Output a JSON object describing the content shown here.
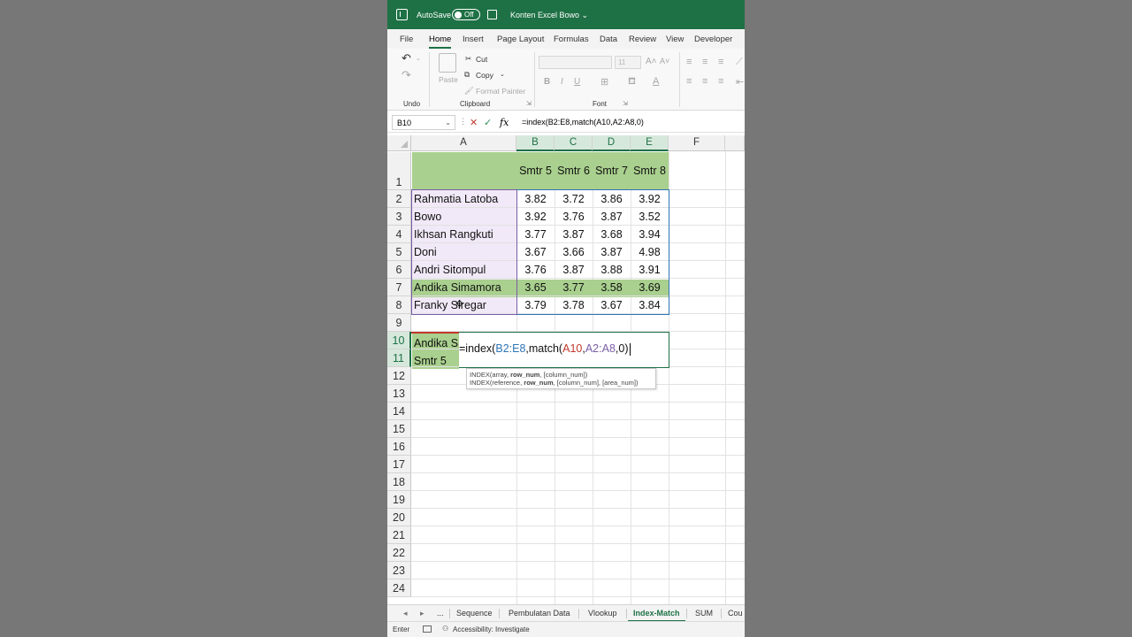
{
  "titlebar": {
    "autosave": "AutoSave",
    "toggle": "Off",
    "doc_title": "Konten Excel Bowo ⌄"
  },
  "ribbon_tabs": [
    "File",
    "Home",
    "Insert",
    "Page Layout",
    "Formulas",
    "Data",
    "Review",
    "View",
    "Developer"
  ],
  "ribbon": {
    "undo_label": "Undo",
    "clipboard_label": "Clipboard",
    "font_label": "Font",
    "paste": "Paste",
    "cut": "Cut",
    "copy": "Copy",
    "format_painter": "Format Painter",
    "font_size": "11"
  },
  "formula_bar": {
    "name_box": "B10",
    "formula": "=index(B2:E8,match(A10,A2:A8,0)"
  },
  "columns": [
    "A",
    "B",
    "C",
    "D",
    "E",
    "F"
  ],
  "rows": [
    "1",
    "2",
    "3",
    "4",
    "5",
    "6",
    "7",
    "8",
    "9",
    "10",
    "11",
    "12",
    "13",
    "14",
    "15",
    "16",
    "17",
    "18",
    "19",
    "20",
    "21",
    "22",
    "23",
    "24"
  ],
  "table": {
    "headers": [
      "Smtr 5",
      "Smtr 6",
      "Smtr 7",
      "Smtr 8"
    ],
    "data": [
      {
        "name": "Rahmatia Latoba",
        "values": [
          "3.82",
          "3.72",
          "3.86",
          "3.92"
        ]
      },
      {
        "name": "Bowo",
        "values": [
          "3.92",
          "3.76",
          "3.87",
          "3.52"
        ]
      },
      {
        "name": "Ikhsan Rangkuti",
        "values": [
          "3.77",
          "3.87",
          "3.68",
          "3.94"
        ]
      },
      {
        "name": "Doni",
        "values": [
          "3.67",
          "3.66",
          "3.87",
          "4.98"
        ]
      },
      {
        "name": "Andri Sitompul",
        "values": [
          "3.76",
          "3.87",
          "3.88",
          "3.91"
        ]
      },
      {
        "name": "Andika Simamora",
        "values": [
          "3.65",
          "3.77",
          "3.58",
          "3.69"
        ]
      },
      {
        "name": "Franky Siregar",
        "values": [
          "3.79",
          "3.78",
          "3.67",
          "3.84"
        ]
      }
    ]
  },
  "lookup": {
    "a10": "Andika S",
    "a11": "Smtr 5"
  },
  "editor": {
    "p1": "=index(",
    "r1": "B2:E8",
    "p2": ",match(",
    "r2": "A10",
    "p3": ",",
    "r3": "A2:A8",
    "p4": ",0)"
  },
  "tooltip": {
    "line1_a": "INDEX(array, ",
    "line1_b": "row_num",
    "line1_c": ", [column_num])",
    "line2_a": "INDEX(reference, ",
    "line2_b": "row_num",
    "line2_c": ", [column_num], [area_num])"
  },
  "sheet_tabs": [
    "...",
    "Sequence",
    "Pembulatan Data",
    "Vlookup",
    "Index-Match",
    "SUM",
    "Cou"
  ],
  "status": {
    "mode": "Enter",
    "accessibility": "Accessibility: Investigate"
  },
  "colors": {
    "excel_green": "#1e7145",
    "header_fill": "#a9d08e",
    "name_fill": "#f1e9f7",
    "ref_blue": "#2f75b5",
    "ref_red": "#c0392b",
    "ref_purple": "#7b5ea7"
  }
}
